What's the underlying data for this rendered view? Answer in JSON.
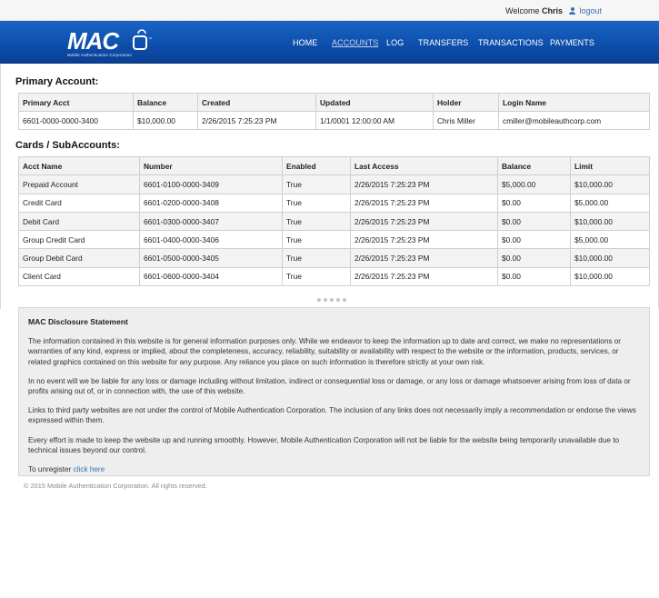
{
  "topbar": {
    "welcome_prefix": "Welcome",
    "user_name": "Chris",
    "logout_label": "logout",
    "user_icon": "user-icon"
  },
  "brand": {
    "logo_text": "MAC",
    "logo_subtitle": "Mobile Authentication Corporation",
    "nav_color": "#0b4aa6",
    "link_color": "#3a6fb5"
  },
  "nav": {
    "items": [
      "HOME",
      "ACCOUNTS",
      "LOG",
      "TRANSFERS",
      "TRANSACTIONS",
      "PAYMENTS"
    ],
    "active": "ACCOUNTS"
  },
  "primary": {
    "title": "Primary Account:",
    "headers": [
      "Primary Acct",
      "Balance",
      "Created",
      "Updated",
      "Holder",
      "Login Name"
    ],
    "row": [
      "6601-0000-0000-3400",
      "$10,000.00",
      "2/26/2015 7:25:23 PM",
      "1/1/0001 12:00:00 AM",
      "Chris Miller",
      "cmiller@mobileauthcorp.com"
    ]
  },
  "cards": {
    "title": "Cards / SubAccounts:",
    "headers": [
      "Acct Name",
      "Number",
      "Enabled",
      "Last Access",
      "Balance",
      "Limit"
    ],
    "rows": [
      [
        "Prepaid Account",
        "6601-0100-0000-3409",
        "True",
        "2/26/2015 7:25:23 PM",
        "$5,000.00",
        "$10,000.00"
      ],
      [
        "Credit Card",
        "6601-0200-0000-3408",
        "True",
        "2/26/2015 7:25:23 PM",
        "$0.00",
        "$5,000.00"
      ],
      [
        "Debit Card",
        "6601-0300-0000-3407",
        "True",
        "2/26/2015 7:25:23 PM",
        "$0.00",
        "$10,000.00"
      ],
      [
        "Group Credit Card",
        "6601-0400-0000-3406",
        "True",
        "2/26/2015 7:25:23 PM",
        "$0.00",
        "$5,000.00"
      ],
      [
        "Group Debit Card",
        "6601-0500-0000-3405",
        "True",
        "2/26/2015 7:25:23 PM",
        "$0.00",
        "$10,000.00"
      ],
      [
        "Client Card",
        "6601-0600-0000-3404",
        "True",
        "2/26/2015 7:25:23 PM",
        "$0.00",
        "$10,000.00"
      ]
    ]
  },
  "disclosure": {
    "title": "MAC Disclosure Statement",
    "p1": "The information contained in this website is for general information purposes only. While we endeavor to keep the information up to date and correct, we make no representations or warranties of any kind, express or implied, about the completeness, accuracy, reliability, suitability or availability with respect to the website or the information, products, services, or related graphics contained on this website for any purpose. Any reliance you place on such information is therefore strictly at your own risk.",
    "p2": "In no event will we be liable for any loss or damage including without limitation, indirect or consequential loss or damage, or any loss or damage whatsoever arising from loss of data or profits arising out of, or in connection with, the use of this website.",
    "p3": "Links to third party websites are not under the control of Mobile Authentication Corporation. The inclusion of any links does not necessarily imply a recommendation or endorse the views expressed within them.",
    "p4": "Every effort is made to keep the website up and running smoothly. However, Mobile Authentication Corporation will not be liable for the website being temporarily unavailable due to technical issues beyond our control.",
    "unregister_prefix": "To unregister",
    "unregister_link": "click here"
  },
  "footer": {
    "copyright": "© 2015 Mobile Authentication Corporation. All rights reserved."
  }
}
